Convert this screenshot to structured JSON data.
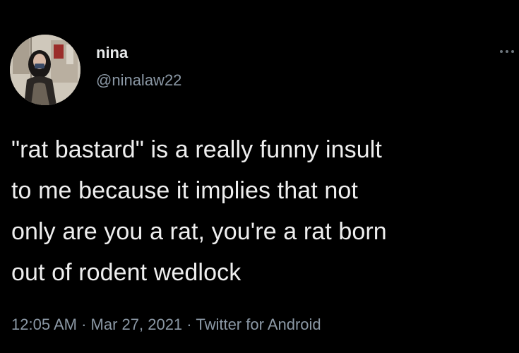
{
  "tweet": {
    "display_name": "nina",
    "handle": "@ninalaw22",
    "avatar_icon": "profile-photo-icon",
    "more_icon": "more-options-icon",
    "text_lines": [
      "\"rat bastard\" is a really funny insult",
      "to me because it implies that not",
      "only are you a rat, you're a rat born",
      "out of rodent wedlock"
    ],
    "time": "12:05 AM",
    "date": "Mar 27, 2021",
    "source": "Twitter for Android",
    "separator": "·"
  },
  "colors": {
    "background": "#000000",
    "primary_text": "#e7e9ea",
    "secondary_text": "#8b98a5"
  }
}
